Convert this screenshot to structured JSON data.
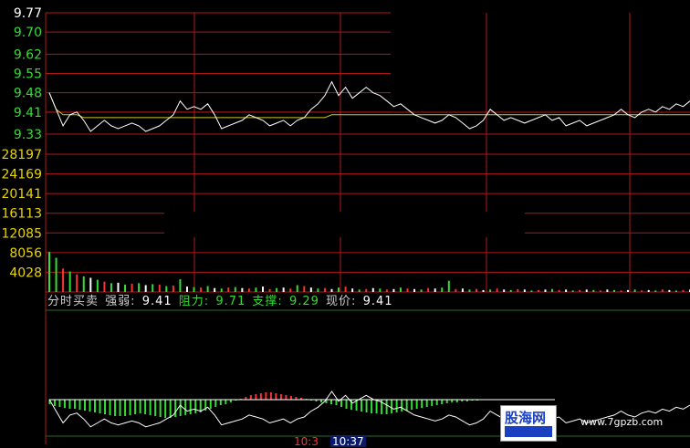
{
  "colors": {
    "background": "#000000",
    "grid": "#b01818",
    "price_line": "#ffffff",
    "avg_line": "#c8c832",
    "up_label": "#ffffff",
    "down_label": "#33dd33",
    "volume_label": "#e8d400",
    "volume_up": "#ff3030",
    "volume_down": "#33dd33",
    "indicator_label": "#cfcfcf",
    "indicator_value": "#ffffff",
    "indicator_green": "#33dd33",
    "macd_up": "#ff3030",
    "macd_down": "#33dd33"
  },
  "indicator_bar": {
    "name": "分时买卖",
    "strength_label": "强弱:",
    "strength_value": "9.41",
    "resistance_label": "阻力:",
    "resistance_value": "9.71",
    "support_label": "支撑:",
    "support_value": "9.29",
    "price_label": "现价:",
    "price_value": "9.41"
  },
  "time_tags": {
    "left": "10:3",
    "right": "10:37"
  },
  "logo": {
    "text": "股海网",
    "icon": "stock-site-logo"
  },
  "site_url": "www.7gpzb.com",
  "chart_data": {
    "type": "line",
    "price_axis": {
      "ticks": [
        "9.77",
        "9.70",
        "9.62",
        "9.55",
        "9.48",
        "9.41",
        "9.33"
      ],
      "tick_values": [
        9.77,
        9.7,
        9.62,
        9.55,
        9.48,
        9.41,
        9.33
      ],
      "tick_colors": [
        "#ffffff",
        "#33dd33",
        "#33dd33",
        "#33dd33",
        "#33dd33",
        "#33dd33",
        "#33dd33"
      ],
      "range": [
        9.33,
        9.77
      ]
    },
    "volume_axis": {
      "ticks": [
        "28197",
        "24169",
        "20141",
        "16113",
        "12085",
        "8056",
        "4028"
      ],
      "tick_values": [
        28197,
        24169,
        20141,
        16113,
        12085,
        8056,
        4028
      ],
      "range": [
        0,
        28197
      ]
    },
    "price": [
      9.48,
      9.42,
      9.36,
      9.4,
      9.41,
      9.38,
      9.34,
      9.36,
      9.38,
      9.36,
      9.35,
      9.36,
      9.37,
      9.36,
      9.34,
      9.35,
      9.36,
      9.38,
      9.4,
      9.45,
      9.42,
      9.43,
      9.42,
      9.44,
      9.4,
      9.35,
      9.36,
      9.37,
      9.38,
      9.4,
      9.39,
      9.38,
      9.36,
      9.37,
      9.38,
      9.36,
      9.38,
      9.39,
      9.42,
      9.44,
      9.47,
      9.52,
      9.47,
      9.5,
      9.46,
      9.48,
      9.5,
      9.48,
      9.47,
      9.45,
      9.43,
      9.44,
      9.42,
      9.4,
      9.39,
      9.38,
      9.37,
      9.38,
      9.4,
      9.39,
      9.37,
      9.35,
      9.36,
      9.38,
      9.42,
      9.4,
      9.38,
      9.39,
      9.38,
      9.37,
      9.38,
      9.39,
      9.4,
      9.38,
      9.39,
      9.36,
      9.37,
      9.38,
      9.36,
      9.37,
      9.38,
      9.39,
      9.4,
      9.42,
      9.4,
      9.39,
      9.41,
      9.42,
      9.41,
      9.43,
      9.42,
      9.44,
      9.43,
      9.45
    ],
    "avg_price": [
      9.48,
      9.42,
      9.4,
      9.4,
      9.4,
      9.39,
      9.39,
      9.39,
      9.39,
      9.39,
      9.39,
      9.39,
      9.39,
      9.39,
      9.39,
      9.39,
      9.39,
      9.39,
      9.39,
      9.39,
      9.39,
      9.39,
      9.39,
      9.39,
      9.39,
      9.39,
      9.39,
      9.39,
      9.39,
      9.39,
      9.39,
      9.39,
      9.39,
      9.39,
      9.39,
      9.39,
      9.39,
      9.39,
      9.39,
      9.39,
      9.39,
      9.4,
      9.4,
      9.4,
      9.4,
      9.4,
      9.4,
      9.4,
      9.4,
      9.4,
      9.4,
      9.4,
      9.4,
      9.4,
      9.4,
      9.4,
      9.4,
      9.4,
      9.4,
      9.4,
      9.4,
      9.4,
      9.4,
      9.4,
      9.4,
      9.4,
      9.4,
      9.4,
      9.4,
      9.4,
      9.4,
      9.4,
      9.4,
      9.4,
      9.4,
      9.4,
      9.4,
      9.4,
      9.4,
      9.4,
      9.4,
      9.4,
      9.4,
      9.4,
      9.4,
      9.4,
      9.4,
      9.4,
      9.4,
      9.4,
      9.4,
      9.4,
      9.4,
      9.4
    ],
    "volume": [
      8200,
      7000,
      4800,
      4200,
      3600,
      3200,
      2900,
      2500,
      2100,
      1800,
      1900,
      1500,
      1700,
      1800,
      1400,
      1600,
      1500,
      1200,
      1300,
      2600,
      1100,
      1000,
      900,
      1200,
      800,
      700,
      900,
      1000,
      800,
      700,
      900,
      1100,
      600,
      800,
      900,
      700,
      1400,
      1200,
      900,
      700,
      800,
      600,
      900,
      1100,
      700,
      500,
      600,
      800,
      700,
      500,
      600,
      900,
      700,
      600,
      500,
      800,
      700,
      900,
      2300,
      600,
      700,
      500,
      600,
      400,
      500,
      700,
      500,
      400,
      600,
      500,
      300,
      400,
      500,
      600,
      400,
      500,
      300,
      400,
      500,
      400,
      300,
      500,
      400,
      300,
      400,
      500,
      300,
      400,
      300,
      500,
      400,
      300,
      400,
      500
    ],
    "volume_dir": [
      "d",
      "d",
      "r",
      "d",
      "r",
      "d",
      "w",
      "d",
      "r",
      "d",
      "w",
      "d",
      "r",
      "d",
      "w",
      "d",
      "r",
      "d",
      "r",
      "d",
      "w",
      "d",
      "r",
      "d",
      "w",
      "d",
      "r",
      "d",
      "w",
      "r",
      "d",
      "w",
      "r",
      "d",
      "w",
      "r",
      "d",
      "r",
      "w",
      "d",
      "r",
      "w",
      "d",
      "r",
      "w",
      "d",
      "r",
      "w",
      "d",
      "r",
      "w",
      "d",
      "r",
      "w",
      "d",
      "r",
      "w",
      "d",
      "d",
      "r",
      "w",
      "d",
      "r",
      "w",
      "d",
      "r",
      "w",
      "d",
      "r",
      "w",
      "d",
      "r",
      "w",
      "d",
      "r",
      "w",
      "d",
      "r",
      "w",
      "d",
      "r",
      "w",
      "d",
      "r",
      "w",
      "d",
      "r",
      "w",
      "d",
      "r",
      "w",
      "d",
      "r",
      "w"
    ],
    "macd": [
      -0.5,
      -0.7,
      -0.8,
      -0.9,
      -1.0,
      -1.0,
      -1.1,
      -1.2,
      -1.3,
      -1.4,
      -1.5,
      -1.6,
      -1.7,
      -1.8,
      -1.8,
      -1.8,
      -1.7,
      -1.6,
      -1.5,
      -1.6,
      -1.7,
      -1.8,
      -1.9,
      -2.0,
      -2.0,
      -1.9,
      -1.8,
      -1.7,
      -1.6,
      -1.5,
      -1.4,
      -1.2,
      -1.0,
      -0.8,
      -0.6,
      -0.5,
      -0.3,
      -0.1,
      0.1,
      0.3,
      0.5,
      0.6,
      0.7,
      0.8,
      0.8,
      0.7,
      0.6,
      0.5,
      0.4,
      0.3,
      0.2,
      0.1,
      -0.1,
      -0.2,
      -0.3,
      -0.4,
      -0.5,
      -0.6,
      -0.8,
      -1.0,
      -1.1,
      -1.2,
      -1.3,
      -1.4,
      -1.5,
      -1.5,
      -1.6,
      -1.6,
      -1.5,
      -1.4,
      -1.3,
      -1.2,
      -1.1,
      -1.0,
      -0.9,
      -0.8,
      -0.7,
      -0.6,
      -0.5,
      -0.4,
      -0.3,
      -0.3,
      -0.2,
      -0.2,
      -0.1,
      -0.1,
      0,
      0,
      0,
      0,
      0,
      0,
      0,
      0
    ],
    "grid": true
  }
}
